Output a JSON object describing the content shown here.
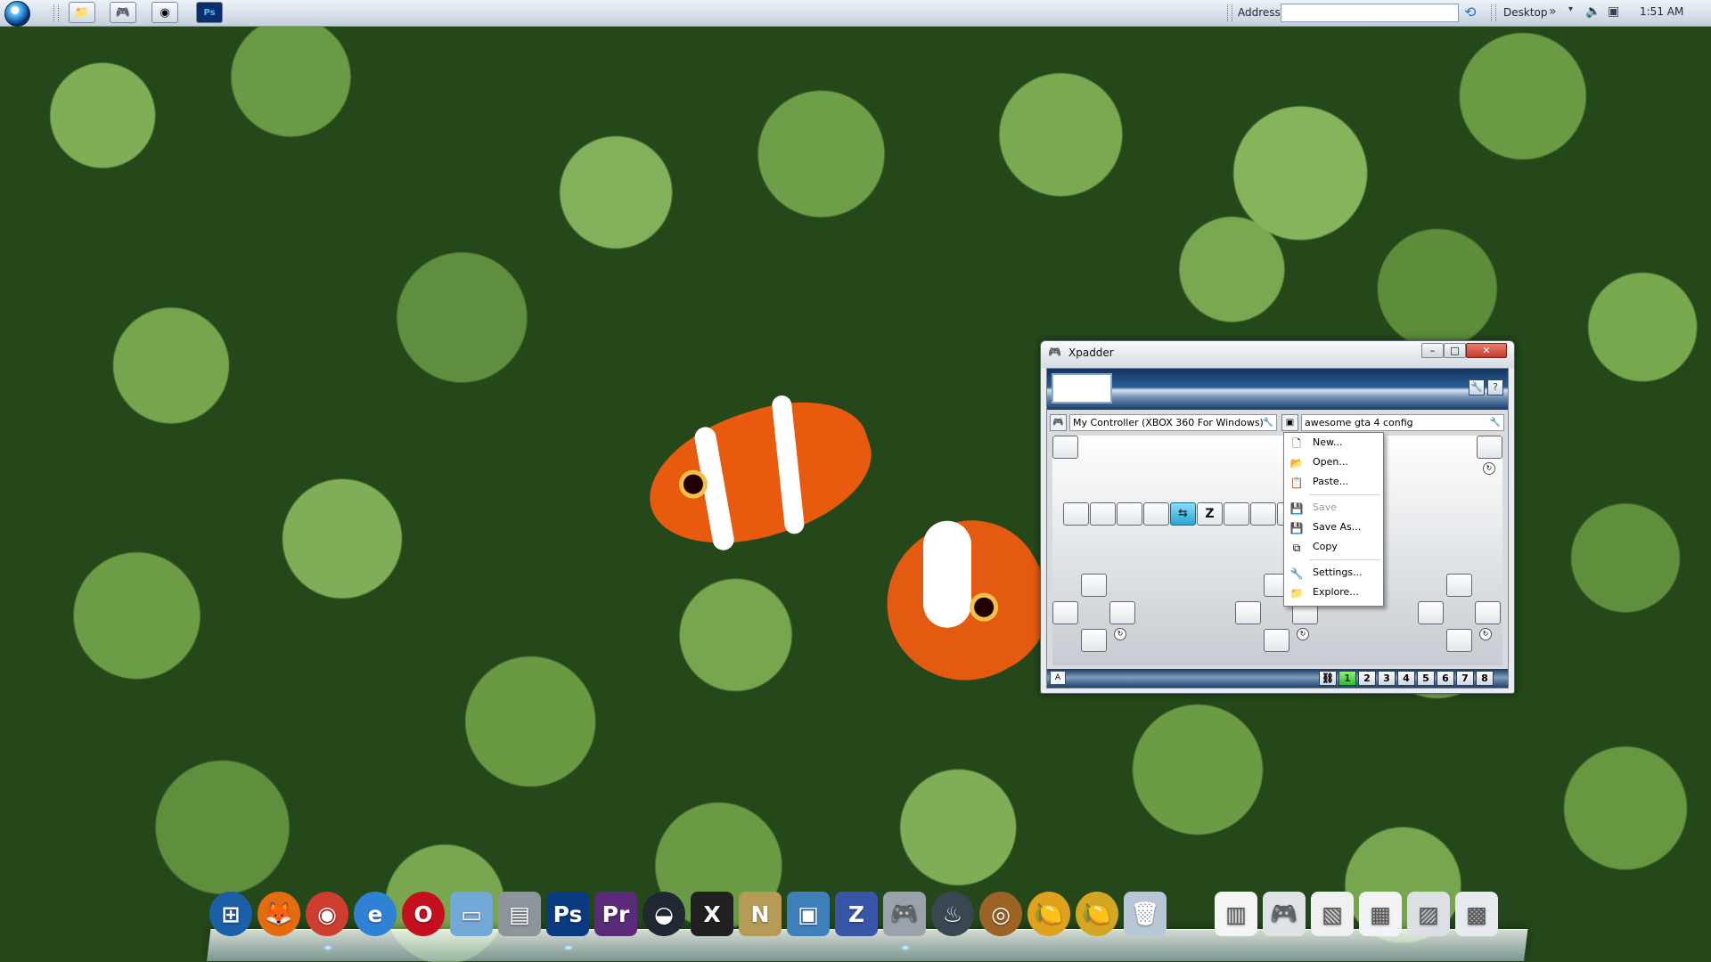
{
  "taskbar": {
    "start_icon": "windows-orb-icon",
    "pinned": [
      {
        "name": "explorer-folder-icon",
        "glyph": "📁"
      },
      {
        "name": "gamepad-icon",
        "glyph": "🎮"
      },
      {
        "name": "chrome-icon",
        "glyph": "◉"
      },
      {
        "name": "photoshop-icon",
        "glyph": "Ps"
      }
    ],
    "address_label": "Address",
    "address_value": "",
    "desktop_label": "Desktop",
    "clock": "1:51 AM"
  },
  "xpadder": {
    "title": "Xpadder",
    "controller": "My Controller (XBOX 360 For Windows)",
    "profile": "awesome gta 4 config",
    "keys": {
      "z_key": "Z",
      "tab_key": "⇆"
    },
    "footer_prefix": "A",
    "sets": [
      "1",
      "2",
      "3",
      "4",
      "5",
      "6",
      "7",
      "8"
    ],
    "active_set": "1"
  },
  "context_menu": {
    "items": [
      {
        "label": "New...",
        "icon": "new-file-icon",
        "glyph": "🗋",
        "enabled": true
      },
      {
        "label": "Open...",
        "icon": "open-folder-icon",
        "glyph": "📂",
        "enabled": true
      },
      {
        "label": "Paste...",
        "icon": "paste-icon",
        "glyph": "📋",
        "enabled": true
      },
      {
        "label": "Save",
        "icon": "save-icon",
        "glyph": "💾",
        "enabled": false
      },
      {
        "label": "Save As...",
        "icon": "save-as-icon",
        "glyph": "💾",
        "enabled": true
      },
      {
        "label": "Copy",
        "icon": "copy-icon",
        "glyph": "⧉",
        "enabled": true
      },
      {
        "label": "Settings...",
        "icon": "settings-wrench-icon",
        "glyph": "🔧",
        "enabled": true
      },
      {
        "label": "Explore...",
        "icon": "explore-folder-icon",
        "glyph": "📁",
        "enabled": true
      }
    ]
  },
  "dock": {
    "icons": [
      {
        "name": "windows-start-dock-icon",
        "glyph": "⊞",
        "color": "#1b5fa8"
      },
      {
        "name": "firefox-icon",
        "glyph": "🦊",
        "color": "#e56b11"
      },
      {
        "name": "chrome-dock-icon",
        "glyph": "◉",
        "color": "#cf3d2e"
      },
      {
        "name": "internet-explorer-icon",
        "glyph": "e",
        "color": "#2f82d3"
      },
      {
        "name": "opera-icon",
        "glyph": "O",
        "color": "#c50f1f"
      },
      {
        "name": "folder-icon",
        "glyph": "▭",
        "color": "#73a9d8"
      },
      {
        "name": "drive-icon",
        "glyph": "▤",
        "color": "#8c949c"
      },
      {
        "name": "photoshop-dock-icon",
        "glyph": "Ps",
        "color": "#0a3a80"
      },
      {
        "name": "premiere-icon",
        "glyph": "Pr",
        "color": "#5b2a7a"
      },
      {
        "name": "xbox-controller-app-icon",
        "glyph": "◒",
        "color": "#1f2833"
      },
      {
        "name": "x-app-icon",
        "glyph": "X",
        "color": "#202020"
      },
      {
        "name": "nvidia-n-icon",
        "glyph": "N",
        "color": "#b59b56"
      },
      {
        "name": "monitor-icon",
        "glyph": "▣",
        "color": "#3f7fba"
      },
      {
        "name": "3d-app-icon",
        "glyph": "Z",
        "color": "#3955a8"
      },
      {
        "name": "gamepad-dock-icon",
        "glyph": "🎮",
        "color": "#9aa3ab"
      },
      {
        "name": "steam-icon",
        "glyph": "♨",
        "color": "#3b4653"
      },
      {
        "name": "orb-app-icon",
        "glyph": "◎",
        "color": "#9b6425"
      },
      {
        "name": "fl-studio-icon",
        "glyph": "🍋",
        "color": "#e0a21d"
      },
      {
        "name": "fl-studio-icon-2",
        "glyph": "🍋",
        "color": "#d5a622"
      },
      {
        "name": "recycle-bin-icon",
        "glyph": "🗑",
        "color": "#b8c7d6"
      },
      {
        "name": "documents-stack-icon",
        "glyph": "▥",
        "color": "#f3f5f7"
      },
      {
        "name": "controller-stack-icon",
        "glyph": "🎮",
        "color": "#dfe3e6"
      },
      {
        "name": "image-stack-icon",
        "glyph": "▧",
        "color": "#eef0f2"
      },
      {
        "name": "folder-stack-icon",
        "glyph": "▦",
        "color": "#f1f3f5"
      },
      {
        "name": "window-stack-icon",
        "glyph": "▨",
        "color": "#dce0e5"
      },
      {
        "name": "photo-stack-icon",
        "glyph": "▩",
        "color": "#e7eaee"
      }
    ]
  }
}
